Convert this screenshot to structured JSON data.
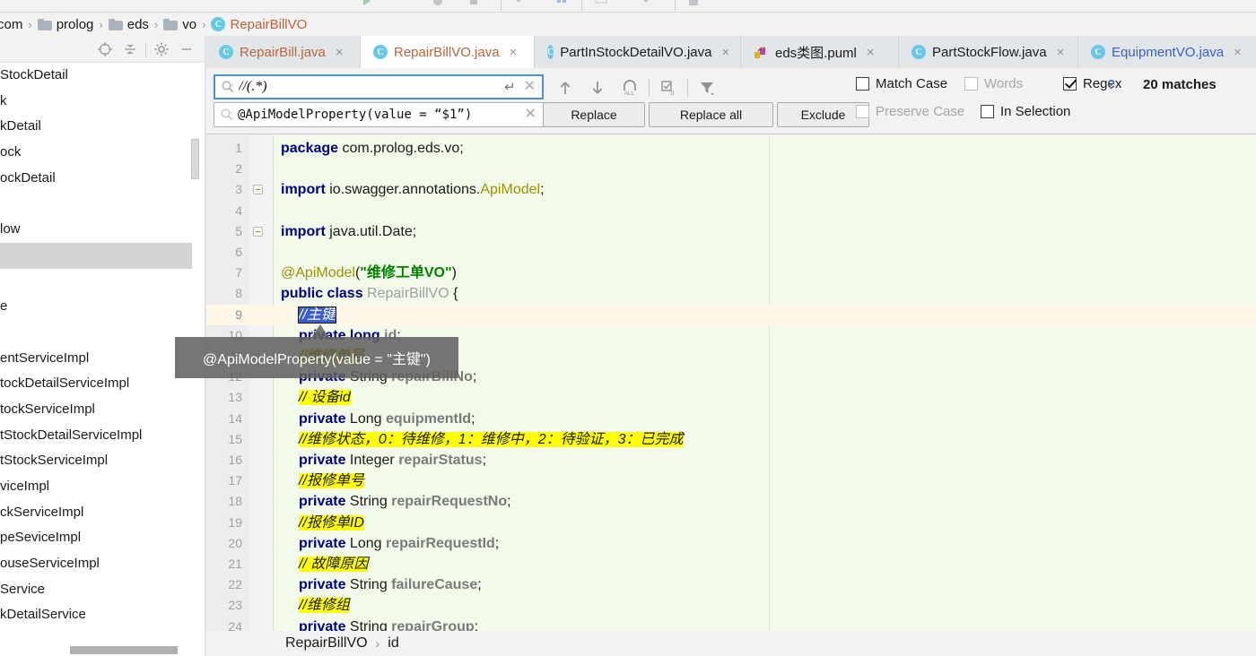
{
  "toolbar": {
    "icons": [
      "run-icon",
      "debug-icon",
      "stop-icon",
      "dropdown-icon",
      "coverage-icon",
      "ruler-icon",
      "chevron-down-icon",
      "save-icon"
    ]
  },
  "breadcrumb": {
    "items": [
      {
        "label": "com",
        "icon": "folder-icon",
        "kind": "folder"
      },
      {
        "label": "prolog",
        "icon": "folder-icon",
        "kind": "folder"
      },
      {
        "label": "eds",
        "icon": "folder-icon",
        "kind": "folder"
      },
      {
        "label": "vo",
        "icon": "folder-icon",
        "kind": "folder"
      },
      {
        "label": "RepairBillVO",
        "icon": "class-icon",
        "kind": "class"
      }
    ],
    "separator": "›"
  },
  "project_panel": {
    "toolbar_icons": [
      "scroll-from-source-icon",
      "collapse-all-icon",
      "settings-gear-icon",
      "hide-panel-icon"
    ],
    "items": [
      "StockDetail",
      "k",
      "kDetail",
      "ock",
      "ockDetail",
      "",
      "low",
      "",
      "",
      "e",
      "",
      "entServiceImpl",
      "tockDetailServiceImpl",
      "tockServiceImpl",
      "tStockDetailServiceImpl",
      "tStockServiceImpl",
      "viceImpl",
      "ckServiceImpl",
      "peSeviceImpl",
      "ouseServiceImpl",
      "Service",
      "kDetailService"
    ],
    "selected_index": 7
  },
  "tabs": [
    {
      "label": "RepairBill.java",
      "icon": "java-class-icon",
      "active": false,
      "color": "orange",
      "close": "×"
    },
    {
      "label": "RepairBillVO.java",
      "icon": "java-class-icon",
      "active": true,
      "color": "orange",
      "close": "×"
    },
    {
      "label": "PartInStockDetailVO.java",
      "icon": "java-class-icon",
      "active": false,
      "color": "dark",
      "close": "×"
    },
    {
      "label": "eds类图.puml",
      "icon": "puml-icon",
      "active": false,
      "color": "dark",
      "close": "×"
    },
    {
      "label": "PartStockFlow.java",
      "icon": "java-class-icon",
      "active": false,
      "color": "dark",
      "close": "×"
    },
    {
      "label": "EquipmentVO.java",
      "icon": "java-class-icon",
      "active": false,
      "color": "blue",
      "close": "×"
    }
  ],
  "find": {
    "search_value": "//(.*)",
    "search_icon": "search-icon",
    "enter_icon": "enter-arrow-icon",
    "clear_icon": "clear-x-icon",
    "replace_value": "@ApiModelProperty(value = “$1”)",
    "nav_icons": [
      "find-previous-icon",
      "find-next-icon",
      "select-all-occurrences-icon",
      "multiline-mode-icon",
      "filter-icon"
    ],
    "buttons": {
      "replace": "Replace",
      "replace_all": "Replace all",
      "exclude": "Exclude"
    },
    "options": [
      {
        "id": "match-case",
        "label": "Match Case",
        "checked": false,
        "disabled": false
      },
      {
        "id": "words",
        "label": "Words",
        "checked": false,
        "disabled": true
      },
      {
        "id": "regex",
        "label": "Regex",
        "checked": true,
        "disabled": false
      },
      {
        "id": "preserve-case",
        "label": "Preserve Case",
        "checked": false,
        "disabled": true
      },
      {
        "id": "in-selection",
        "label": "In Selection",
        "checked": false,
        "disabled": false
      }
    ],
    "help": "?",
    "match_count": "20 matches"
  },
  "editor": {
    "lines": [
      {
        "n": "1",
        "indent": 0,
        "html": "<span class=\"kw\">package</span> <span class=\"pln\">com.prolog.eds.vo;</span>"
      },
      {
        "n": "2",
        "indent": 0,
        "html": ""
      },
      {
        "n": "3",
        "indent": 0,
        "fold": true,
        "html": "<span class=\"kw\">import</span> <span class=\"pln\">io.swagger.annotations.</span><span class=\"anno\">ApiModel</span><span class=\"pln\">;</span>"
      },
      {
        "n": "4",
        "indent": 0,
        "html": ""
      },
      {
        "n": "5",
        "indent": 0,
        "fold": true,
        "html": "<span class=\"kw\">import</span> <span class=\"pln\">java.util.Date;</span>"
      },
      {
        "n": "6",
        "indent": 0,
        "html": ""
      },
      {
        "n": "7",
        "indent": 0,
        "html": "<span class=\"anno\">@ApiModel</span><span class=\"pln\">(</span><span class=\"str\">\"维修工单VO\"</span><span class=\"pln\">)</span>"
      },
      {
        "n": "8",
        "indent": 0,
        "html": "<span class=\"kw\">public class</span> <span class=\"cls\">RepairBillVO</span> <span class=\"pln\">{</span>"
      },
      {
        "n": "9",
        "indent": 1,
        "cursor": true,
        "html": "<span class=\"selhl\">//主键</span>"
      },
      {
        "n": "10",
        "indent": 1,
        "html": "<span class=\"kw\">private long</span> <span class=\"fld\">id</span><span class=\"pln\">;</span>"
      },
      {
        "n": "11",
        "indent": 1,
        "html": "<span class=\"hl\">//维修单号</span>"
      },
      {
        "n": "12",
        "indent": 1,
        "html": "<span class=\"kw\">private</span> <span class=\"type\">String</span> <span class=\"fld\">repairBillNo</span><span class=\"pln\">;</span>"
      },
      {
        "n": "13",
        "indent": 1,
        "html": "<span class=\"hl\">// 设备id</span>"
      },
      {
        "n": "14",
        "indent": 1,
        "html": "<span class=\"kw\">private</span> <span class=\"type\">Long</span> <span class=\"fld\">equipmentId</span><span class=\"pln\">;</span>"
      },
      {
        "n": "15",
        "indent": 1,
        "html": "<span class=\"hl\">//维修状态，0：待维修，1：维修中，2：待验证，3：已完成</span>"
      },
      {
        "n": "16",
        "indent": 1,
        "html": "<span class=\"kw\">private</span> <span class=\"type\">Integer</span> <span class=\"fld\">repairStatus</span><span class=\"pln\">;</span>"
      },
      {
        "n": "17",
        "indent": 1,
        "html": "<span class=\"hl\">//报修单号</span>"
      },
      {
        "n": "18",
        "indent": 1,
        "html": "<span class=\"kw\">private</span> <span class=\"type\">String</span> <span class=\"fld\">repairRequestNo</span><span class=\"pln\">;</span>"
      },
      {
        "n": "19",
        "indent": 1,
        "html": "<span class=\"hl\">//报修单ID</span>"
      },
      {
        "n": "20",
        "indent": 1,
        "html": "<span class=\"kw\">private</span> <span class=\"type\">Long</span> <span class=\"fld\">repairRequestId</span><span class=\"pln\">;</span>"
      },
      {
        "n": "21",
        "indent": 1,
        "html": "<span class=\"hl\">// 故障原因</span>"
      },
      {
        "n": "22",
        "indent": 1,
        "html": "<span class=\"kw\">private</span> <span class=\"type\">String</span> <span class=\"fld\">failureCause</span><span class=\"pln\">;</span>"
      },
      {
        "n": "23",
        "indent": 1,
        "html": "<span class=\"hl\">//维修组</span>"
      },
      {
        "n": "24",
        "indent": 1,
        "html": "<span class=\"kw\">private</span> <span class=\"type\">String</span> <span class=\"fld\">repairGroup</span><span class=\"pln\">;</span>"
      }
    ]
  },
  "tooltip": {
    "text": "@ApiModelProperty(value = \"主键\")"
  },
  "status_breadcrumb": {
    "items": [
      "RepairBillVO",
      "id"
    ],
    "separator": "›"
  },
  "colors": {
    "editor_bg": "#f2fbe9",
    "highlight": "#ffff00",
    "selection": "#3a5fcd",
    "cursor_line": "#fdf7e7",
    "accent_blue": "#4a90d9",
    "tab_orange": "#b9643c"
  }
}
